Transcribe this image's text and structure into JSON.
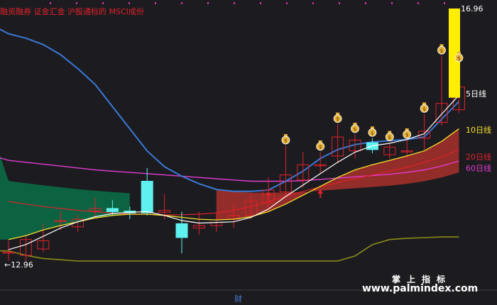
{
  "header": {
    "tags": "融资融券 证金汇金 沪股通标的 MSCI成份"
  },
  "price_labels": {
    "high": "16.96",
    "low": "←12.96"
  },
  "ma_labels": {
    "ma5": "5日线",
    "ma10": "10日线",
    "ma20": "20日线",
    "ma60": "60日线"
  },
  "watermark": {
    "title": "掌上指标",
    "url": "www.palmindex.com"
  },
  "footer": {
    "finance_mark": "财"
  },
  "colors": {
    "background": "#1c1c20",
    "up": "#e0202a",
    "down": "#5ff0f0",
    "ma5": "#ffffff",
    "ma10": "#f5e12e",
    "ma20": "#e0202a",
    "ma60": "#e03ccf",
    "upper_band": "#3a78d6",
    "lower_band": "#8b8b1a",
    "green_fill": "#0b6b45",
    "red_fill": "#a8302c",
    "signal_bar": "#ffee00",
    "money_bag": "#e8b43a"
  },
  "chart_data": {
    "type": "candlestick",
    "y_range": [
      12.96,
      16.96
    ],
    "candles": [
      {
        "o": 13.1,
        "c": 13.1,
        "h": 13.28,
        "l": 12.96
      },
      {
        "o": 13.05,
        "c": 13.3,
        "h": 13.35,
        "l": 12.96
      },
      {
        "o": 13.15,
        "c": 13.28,
        "h": 13.55,
        "l": 13.1
      },
      {
        "o": 13.6,
        "c": 13.6,
        "h": 13.75,
        "l": 13.45
      },
      {
        "o": 13.5,
        "c": 13.62,
        "h": 13.7,
        "l": 13.42
      },
      {
        "o": 13.75,
        "c": 13.79,
        "h": 13.96,
        "l": 13.65
      },
      {
        "o": 13.79,
        "c": 13.74,
        "h": 13.92,
        "l": 13.68
      },
      {
        "o": 13.75,
        "c": 13.72,
        "h": 13.82,
        "l": 13.62
      },
      {
        "o": 14.22,
        "c": 13.72,
        "h": 14.43,
        "l": 13.68
      },
      {
        "o": 13.73,
        "c": 13.76,
        "h": 14.02,
        "l": 13.62
      },
      {
        "o": 13.55,
        "c": 13.33,
        "h": 13.74,
        "l": 13.08
      },
      {
        "o": 13.48,
        "c": 13.52,
        "h": 13.74,
        "l": 13.38
      },
      {
        "o": 13.52,
        "c": 13.57,
        "h": 13.71,
        "l": 13.42
      },
      {
        "o": 13.62,
        "c": 13.68,
        "h": 13.88,
        "l": 13.48
      },
      {
        "o": 13.68,
        "c": 13.91,
        "h": 14.02,
        "l": 13.62
      },
      {
        "o": 13.88,
        "c": 14.08,
        "h": 14.28,
        "l": 13.78
      },
      {
        "o": 14.05,
        "c": 14.32,
        "h": 14.78,
        "l": 14.0
      },
      {
        "o": 14.24,
        "c": 14.48,
        "h": 14.68,
        "l": 14.12
      },
      {
        "o": 14.48,
        "c": 14.48,
        "h": 14.68,
        "l": 14.34
      },
      {
        "o": 14.62,
        "c": 14.92,
        "h": 15.12,
        "l": 14.52
      },
      {
        "o": 14.7,
        "c": 14.87,
        "h": 14.96,
        "l": 14.58
      },
      {
        "o": 14.83,
        "c": 14.72,
        "h": 14.9,
        "l": 14.66
      },
      {
        "o": 14.64,
        "c": 14.76,
        "h": 14.83,
        "l": 14.58
      },
      {
        "o": 14.7,
        "c": 14.7,
        "h": 14.87,
        "l": 14.58
      },
      {
        "o": 14.9,
        "c": 15.01,
        "h": 15.28,
        "l": 14.72
      },
      {
        "o": 15.15,
        "c": 15.45,
        "h": 16.2,
        "l": 15.1
      },
      {
        "o": 15.35,
        "c": 15.71,
        "h": 16.08,
        "l": 15.3
      }
    ],
    "ma5": [
      13.14,
      13.22,
      13.35,
      13.48,
      13.58,
      13.66,
      13.71,
      13.73,
      13.74,
      13.68,
      13.6,
      13.56,
      13.57,
      13.58,
      13.65,
      13.78,
      13.98,
      14.16,
      14.34,
      14.52,
      14.68,
      14.78,
      14.82,
      14.88,
      14.97,
      15.28,
      15.58
    ],
    "ma10": [
      13.3,
      13.36,
      13.45,
      13.52,
      13.58,
      13.64,
      13.68,
      13.7,
      13.7,
      13.68,
      13.65,
      13.62,
      13.61,
      13.62,
      13.66,
      13.74,
      13.86,
      14.0,
      14.14,
      14.28,
      14.4,
      14.48,
      14.55,
      14.62,
      14.7,
      14.85,
      15.05
    ],
    "ma20": [
      13.9,
      13.86,
      13.82,
      13.79,
      13.76,
      13.74,
      13.72,
      13.7,
      13.7,
      13.69,
      13.69,
      13.7,
      13.72,
      13.76,
      13.82,
      13.9,
      13.98,
      14.06,
      14.13,
      14.2,
      14.26,
      14.32,
      14.38,
      14.44,
      14.52,
      14.6,
      14.72
    ],
    "ma60": [
      14.55,
      14.52,
      14.49,
      14.46,
      14.43,
      14.4,
      14.38,
      14.36,
      14.34,
      14.32,
      14.3,
      14.28,
      14.26,
      14.24,
      14.22,
      14.22,
      14.22,
      14.23,
      14.25,
      14.27,
      14.29,
      14.31,
      14.33,
      14.36,
      14.4,
      14.46,
      14.54
    ],
    "upper_band": [
      16.55,
      16.48,
      16.38,
      16.22,
      16.0,
      15.75,
      15.4,
      15.05,
      14.7,
      14.45,
      14.3,
      14.18,
      14.09,
      14.06,
      14.06,
      14.08,
      14.22,
      14.38,
      14.58,
      14.72,
      14.8,
      14.84,
      14.86,
      14.88,
      14.92,
      15.2,
      15.48
    ],
    "lower_band": [
      13.12,
      13.05,
      13.0,
      12.98,
      12.96,
      12.96,
      12.96,
      12.96,
      12.96,
      12.96,
      12.96,
      12.96,
      12.96,
      12.96,
      12.96,
      12.96,
      12.96,
      12.96,
      12.96,
      12.96,
      13.04,
      13.22,
      13.3,
      13.32,
      13.33,
      13.34,
      13.34
    ],
    "signal_bar": {
      "top": 16.96,
      "bottom": 15.55
    },
    "money_bags_at": [
      16,
      18,
      19,
      20,
      21,
      22,
      23,
      24,
      25,
      26
    ],
    "up_arrows_at": [
      15,
      18
    ]
  }
}
